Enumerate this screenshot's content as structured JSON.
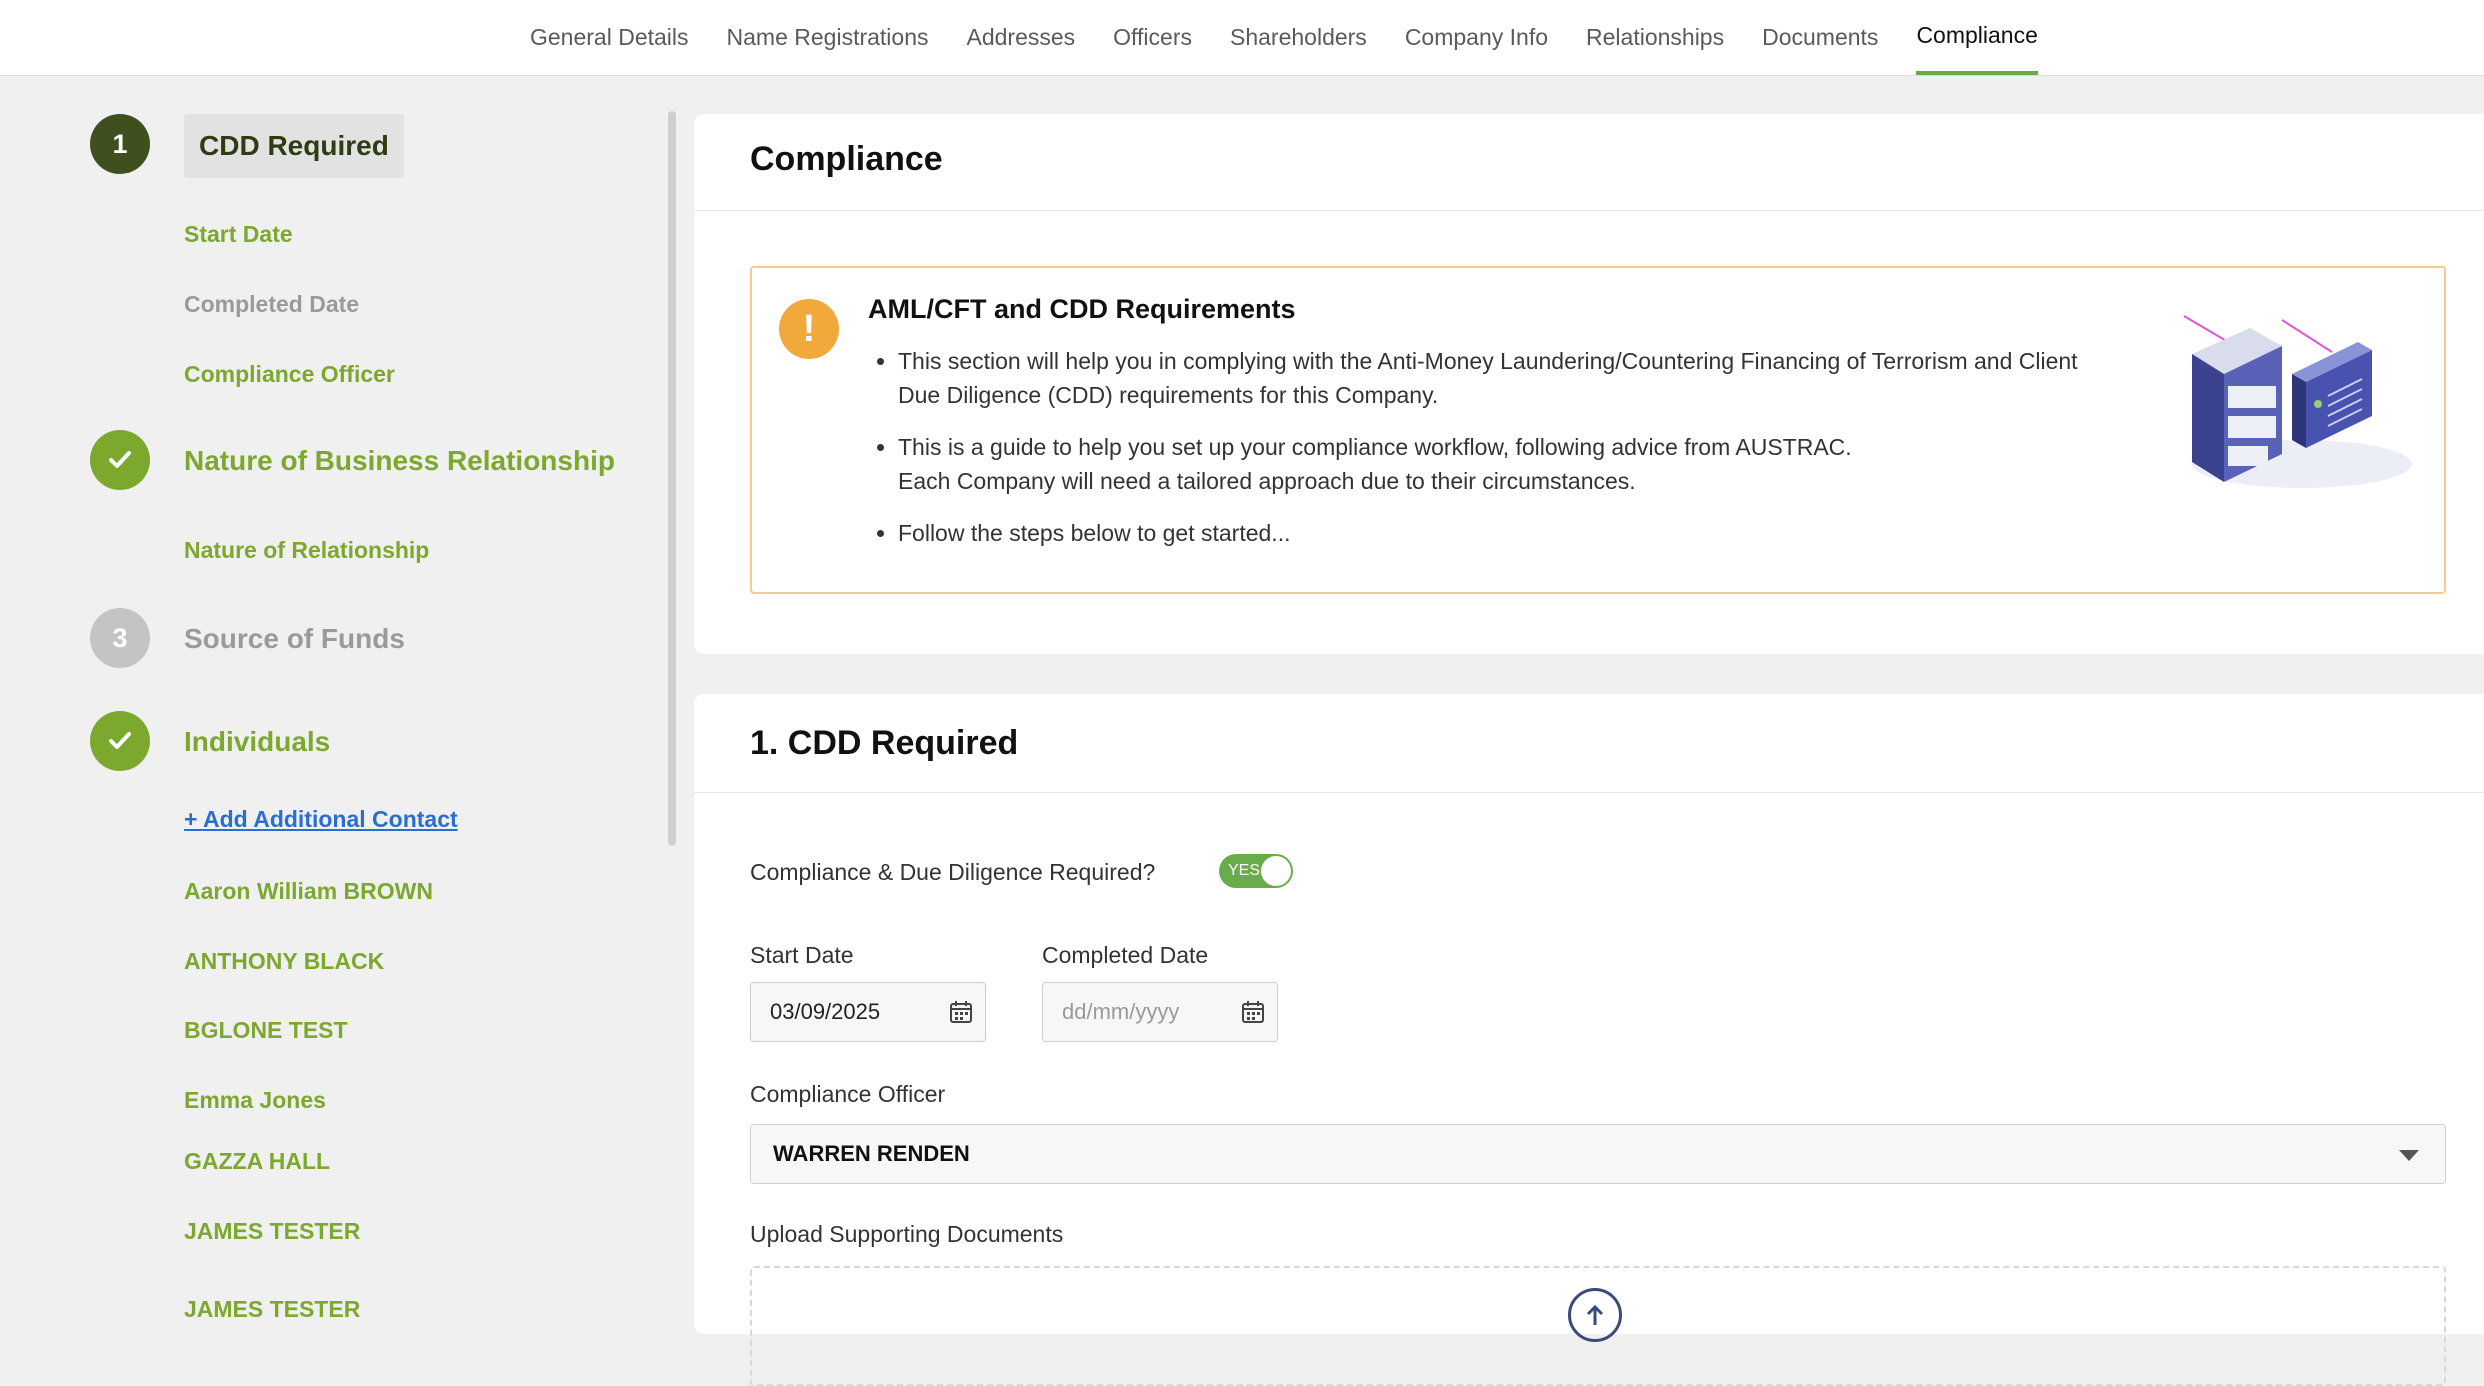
{
  "nav": {
    "tabs": [
      {
        "label": "General Details"
      },
      {
        "label": "Name Registrations"
      },
      {
        "label": "Addresses"
      },
      {
        "label": "Officers"
      },
      {
        "label": "Shareholders"
      },
      {
        "label": "Company Info"
      },
      {
        "label": "Relationships"
      },
      {
        "label": "Documents"
      },
      {
        "label": "Compliance"
      }
    ],
    "active_tab": "Compliance"
  },
  "sidebar": {
    "step1": {
      "number": "1",
      "title": "CDD Required",
      "items": [
        "Start Date",
        "Completed Date",
        "Compliance Officer"
      ]
    },
    "step2": {
      "title": "Nature of Business Relationship",
      "items": [
        "Nature of Relationship"
      ]
    },
    "step3": {
      "number": "3",
      "title": "Source of Funds"
    },
    "step4": {
      "title": "Individuals",
      "add_contact": "+ Add Additional Contact",
      "contacts": [
        "Aaron William BROWN",
        "ANTHONY BLACK",
        "BGLONE TEST",
        "Emma Jones",
        "GAZZA HALL",
        "JAMES TESTER",
        "JAMES TESTER"
      ]
    }
  },
  "compliance_card": {
    "title": "Compliance",
    "alert": {
      "icon": "!",
      "title": "AML/CFT and CDD Requirements",
      "bullets": [
        "This section will help you in complying with the Anti-Money Laundering/Countering Financing of Terrorism and Client Due Diligence (CDD) requirements for this Company.",
        "This is a guide to help you set up your compliance workflow, following advice from AUSTRAC.",
        "Each Company will need a tailored approach due to their circumstances.",
        "Follow the steps below to get started..."
      ]
    }
  },
  "cdd_card": {
    "title": "1. CDD Required",
    "cdd_required_label": "Compliance & Due Diligence Required?",
    "toggle_text": "YES",
    "start_date_label": "Start Date",
    "start_date_value": "03/09/2025",
    "completed_date_label": "Completed Date",
    "completed_date_placeholder": "dd/mm/yyyy",
    "officer_label": "Compliance Officer",
    "officer_value": "WARREN RENDEN",
    "upload_label": "Upload Supporting Documents"
  },
  "colors": {
    "accent_green": "#7ca82e",
    "active_step": "#3f4f1e",
    "warning": "#f2a93b",
    "link": "#2a6fd0"
  }
}
